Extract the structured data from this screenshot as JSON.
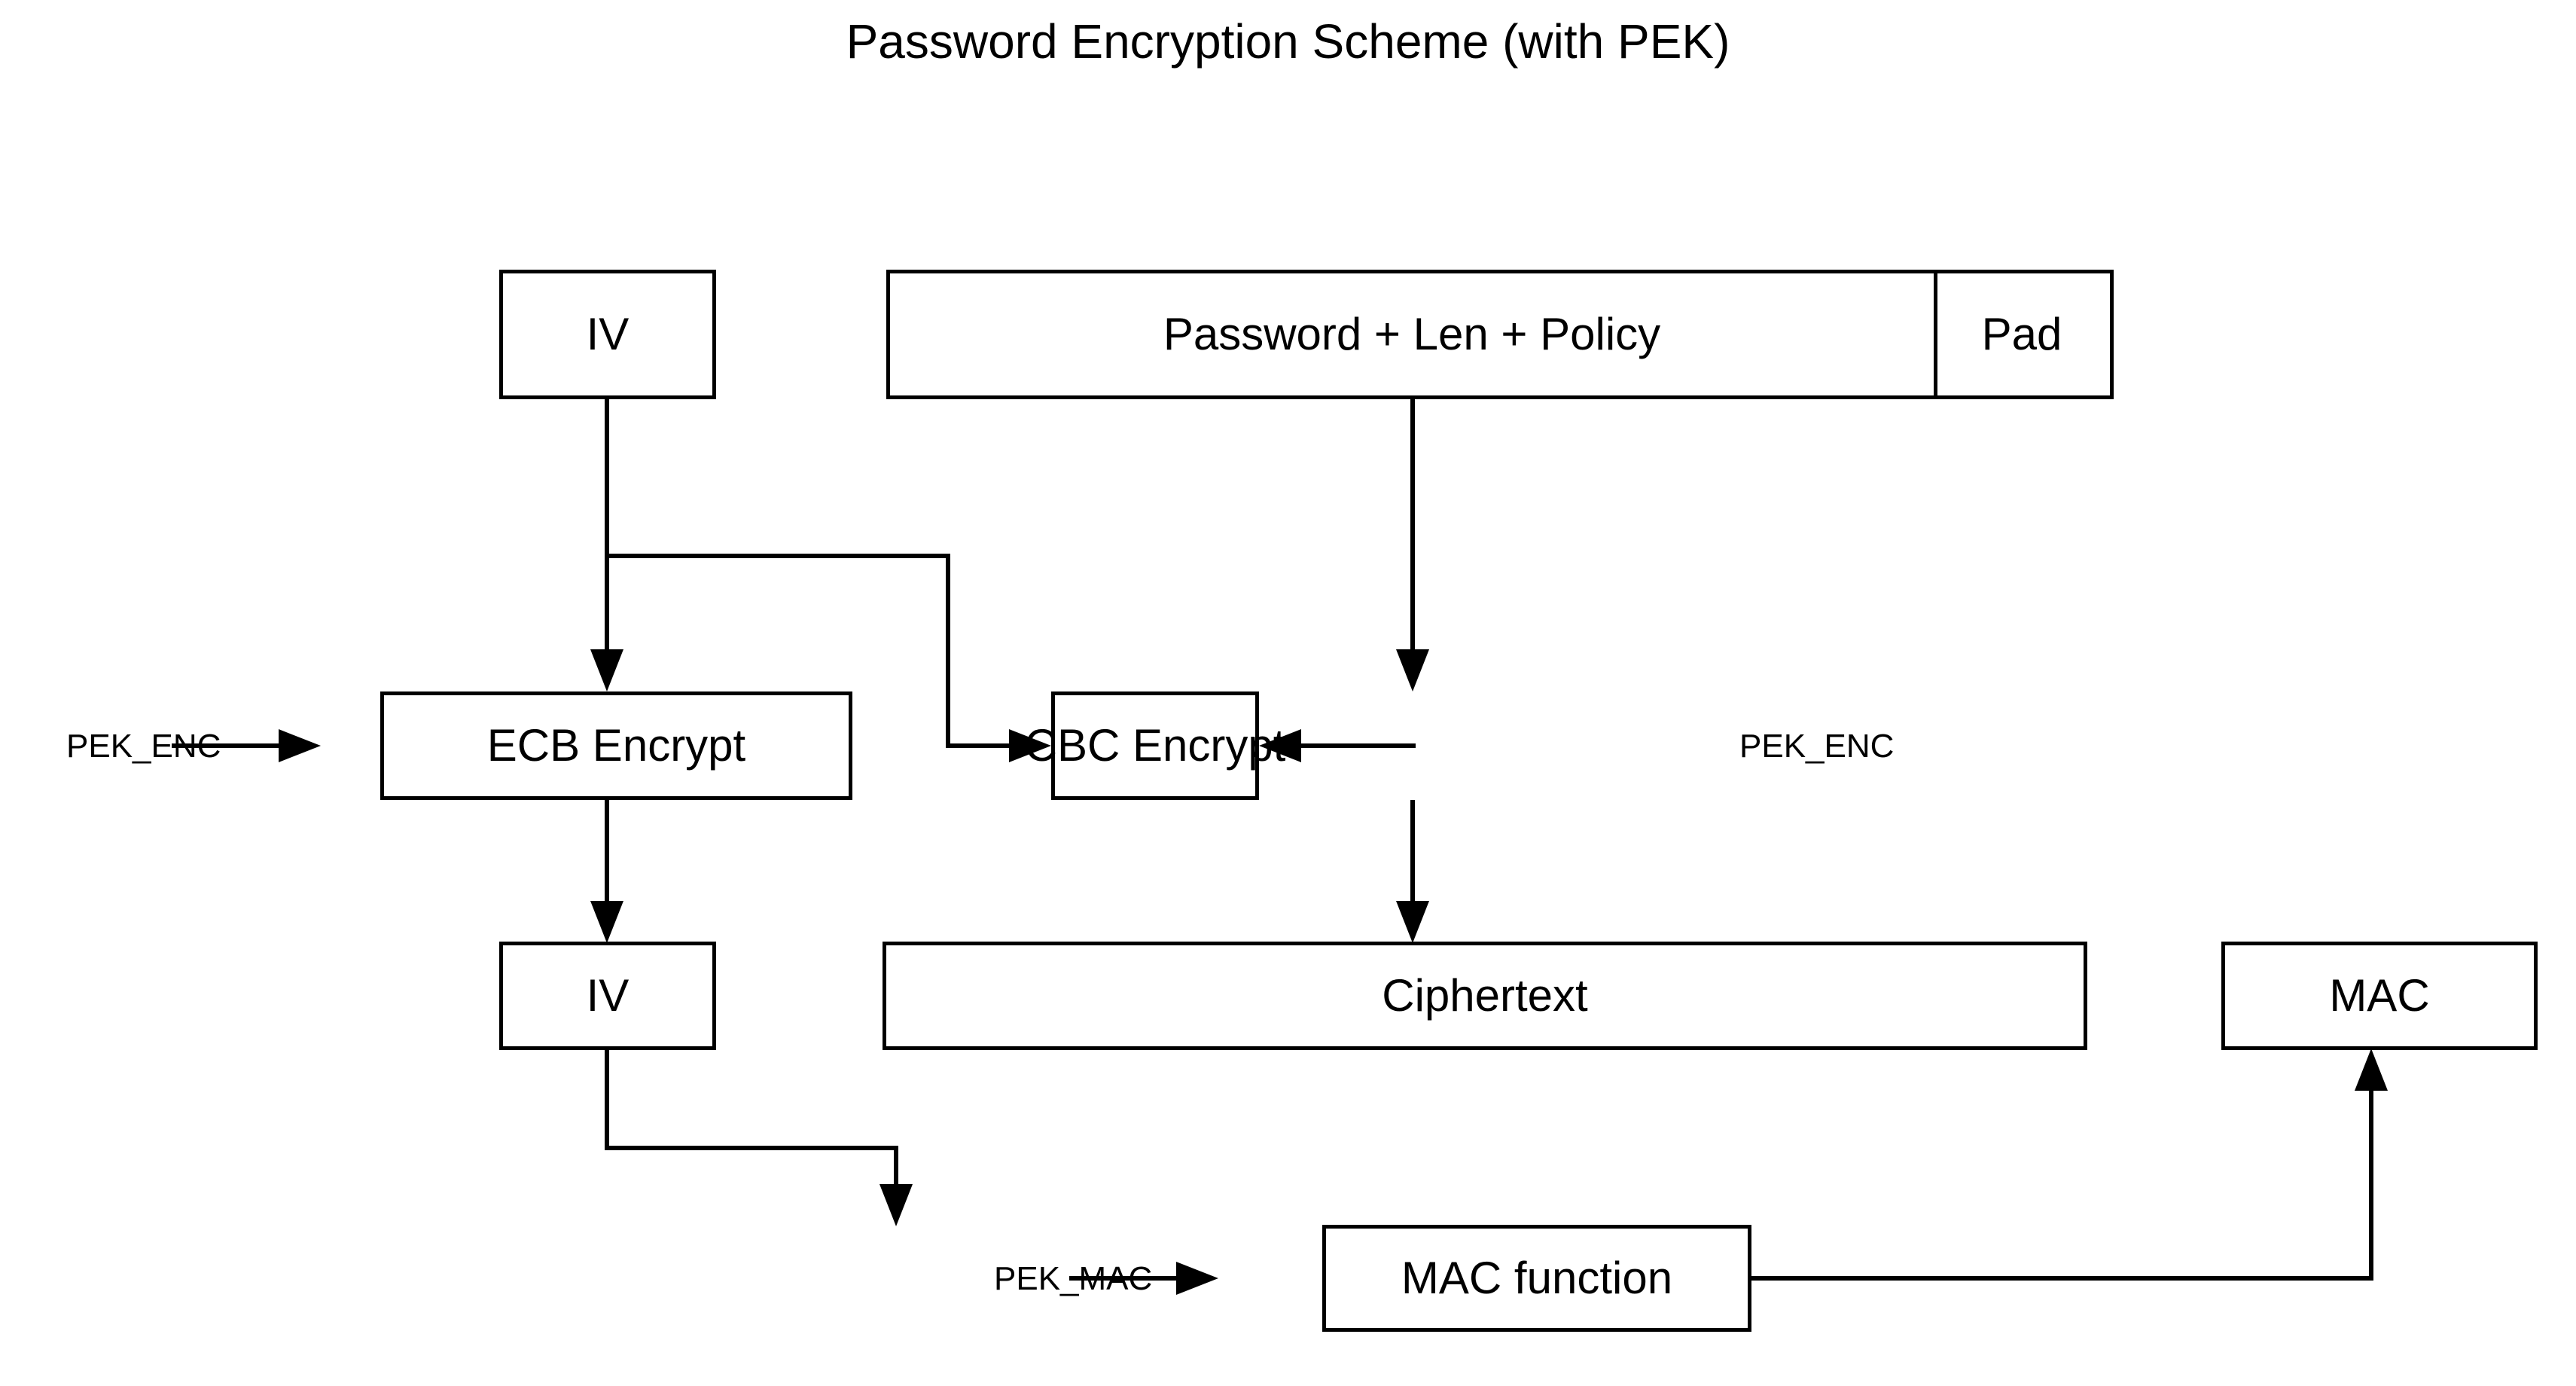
{
  "diagram": {
    "title": "Password Encryption Scheme (with PEK)",
    "background_color": "#ffffff",
    "line_color": "#000000",
    "boxes": {
      "iv_top": "IV",
      "password": "Password + Len + Policy",
      "pad": "Pad",
      "ecb_encrypt": "ECB Encrypt",
      "cbc_encrypt": "CBC Encrypt",
      "iv_bottom": "IV",
      "ciphertext": "Ciphertext",
      "mac_output": "MAC",
      "mac_function": "MAC function"
    },
    "key_labels": {
      "pek_enc_left": "PEK_ENC",
      "pek_enc_right": "PEK_ENC",
      "pek_mac": "PEK_MAC"
    },
    "flows": [
      {
        "from": "iv_top",
        "to": "ecb_encrypt",
        "arrow": "down"
      },
      {
        "from": "iv_top",
        "to": "cbc_encrypt",
        "arrow": "right"
      },
      {
        "from": "password",
        "to": "cbc_encrypt",
        "arrow": "down"
      },
      {
        "from": "pek_enc_left",
        "to": "ecb_encrypt",
        "arrow": "right"
      },
      {
        "from": "pek_enc_right",
        "to": "cbc_encrypt",
        "arrow": "left"
      },
      {
        "from": "ecb_encrypt",
        "to": "iv_bottom",
        "arrow": "down"
      },
      {
        "from": "cbc_encrypt",
        "to": "ciphertext",
        "arrow": "down"
      },
      {
        "from": "iv_bottom",
        "to": "mac_function",
        "arrow": "down"
      },
      {
        "from": "pek_mac",
        "to": "mac_function",
        "arrow": "right"
      },
      {
        "from": "mac_function",
        "to": "mac_output",
        "arrow": "up"
      }
    ]
  }
}
